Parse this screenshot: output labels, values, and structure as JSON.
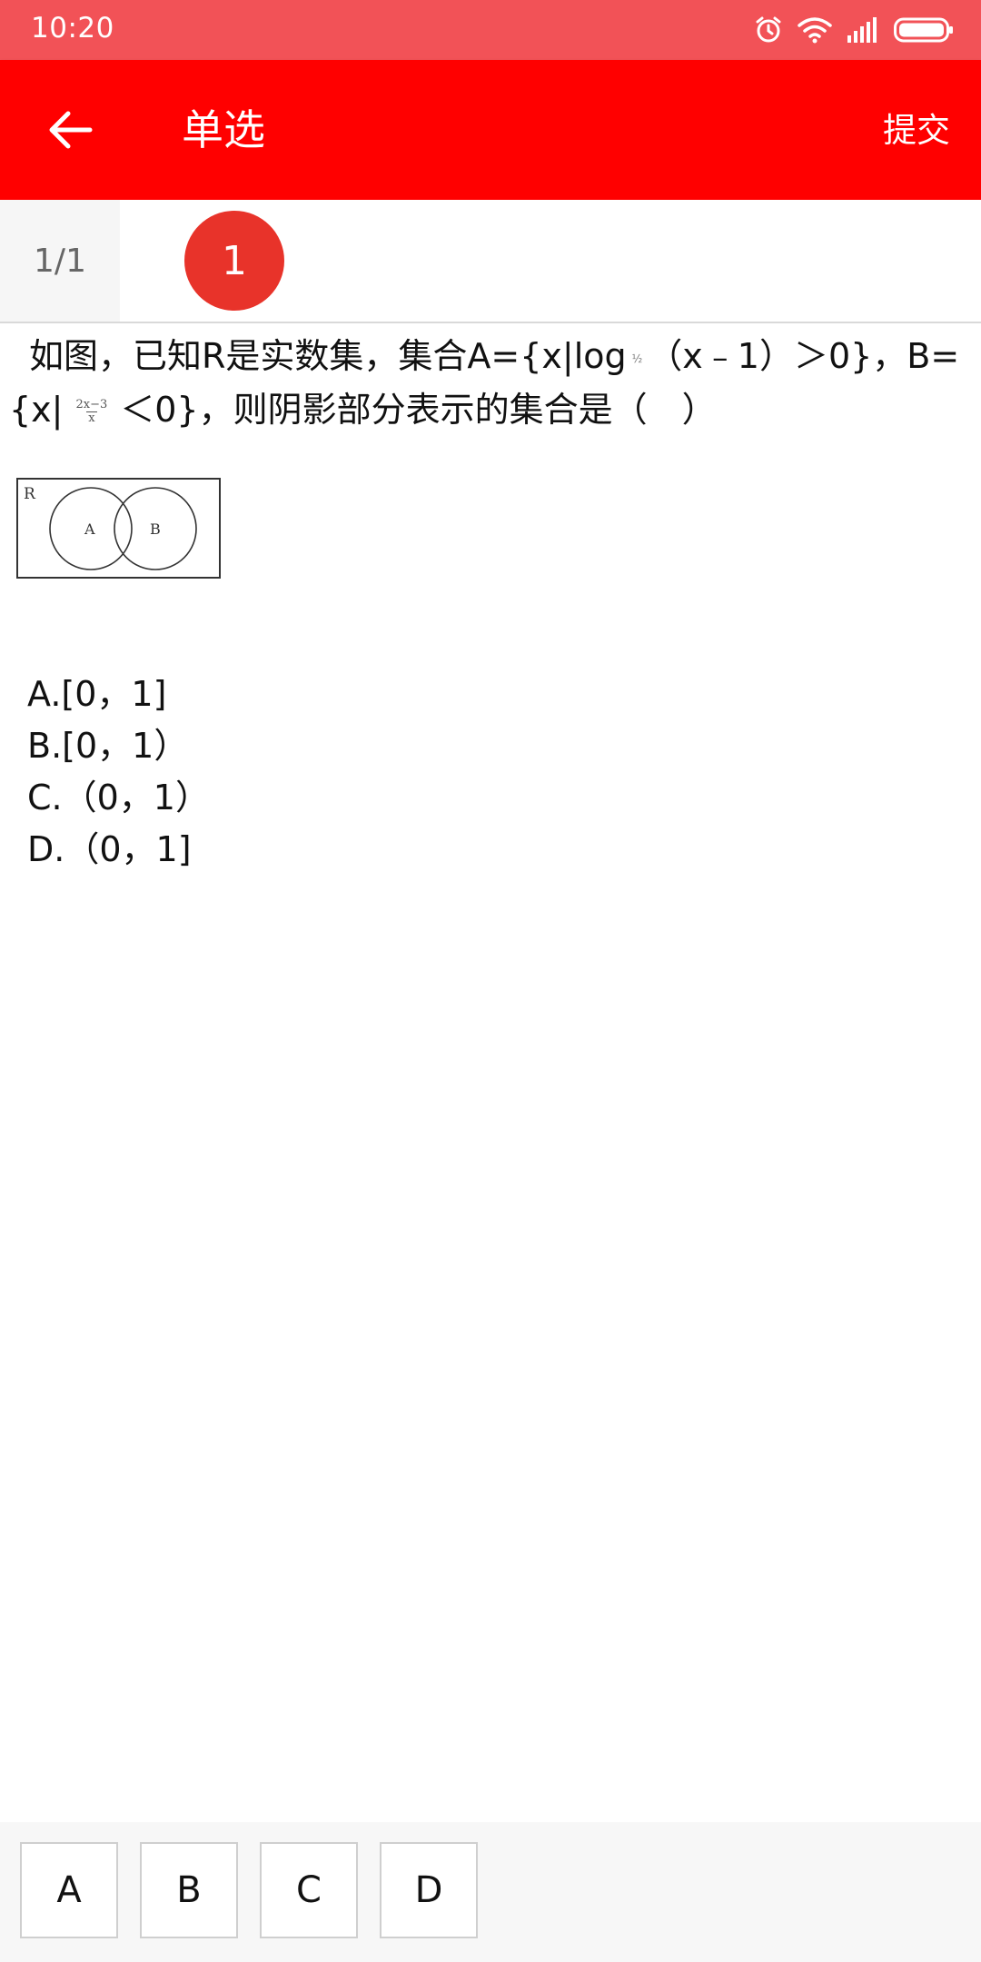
{
  "status_bar": {
    "time": "10:20"
  },
  "app_bar": {
    "title": "单选",
    "submit_label": "提交"
  },
  "question_nav": {
    "counter": "1/1",
    "items": [
      "1"
    ]
  },
  "question": {
    "text_part1": "如图，已知R是实数集，集合A={x|log",
    "log_base": "½",
    "text_part2": "（x﹣1）＞0}，B={x|",
    "frac_num": "2x−3",
    "frac_den": "x",
    "text_part3": "＜0}，则阴影部分表示的集合是（　）",
    "venn": {
      "universe_label": "R",
      "set_a": "A",
      "set_b": "B"
    }
  },
  "options": [
    "A.[0，1]",
    "B.[0，1）",
    "C.（0，1）",
    "D.（0，1]"
  ],
  "answer_buttons": [
    "A",
    "B",
    "C",
    "D"
  ]
}
